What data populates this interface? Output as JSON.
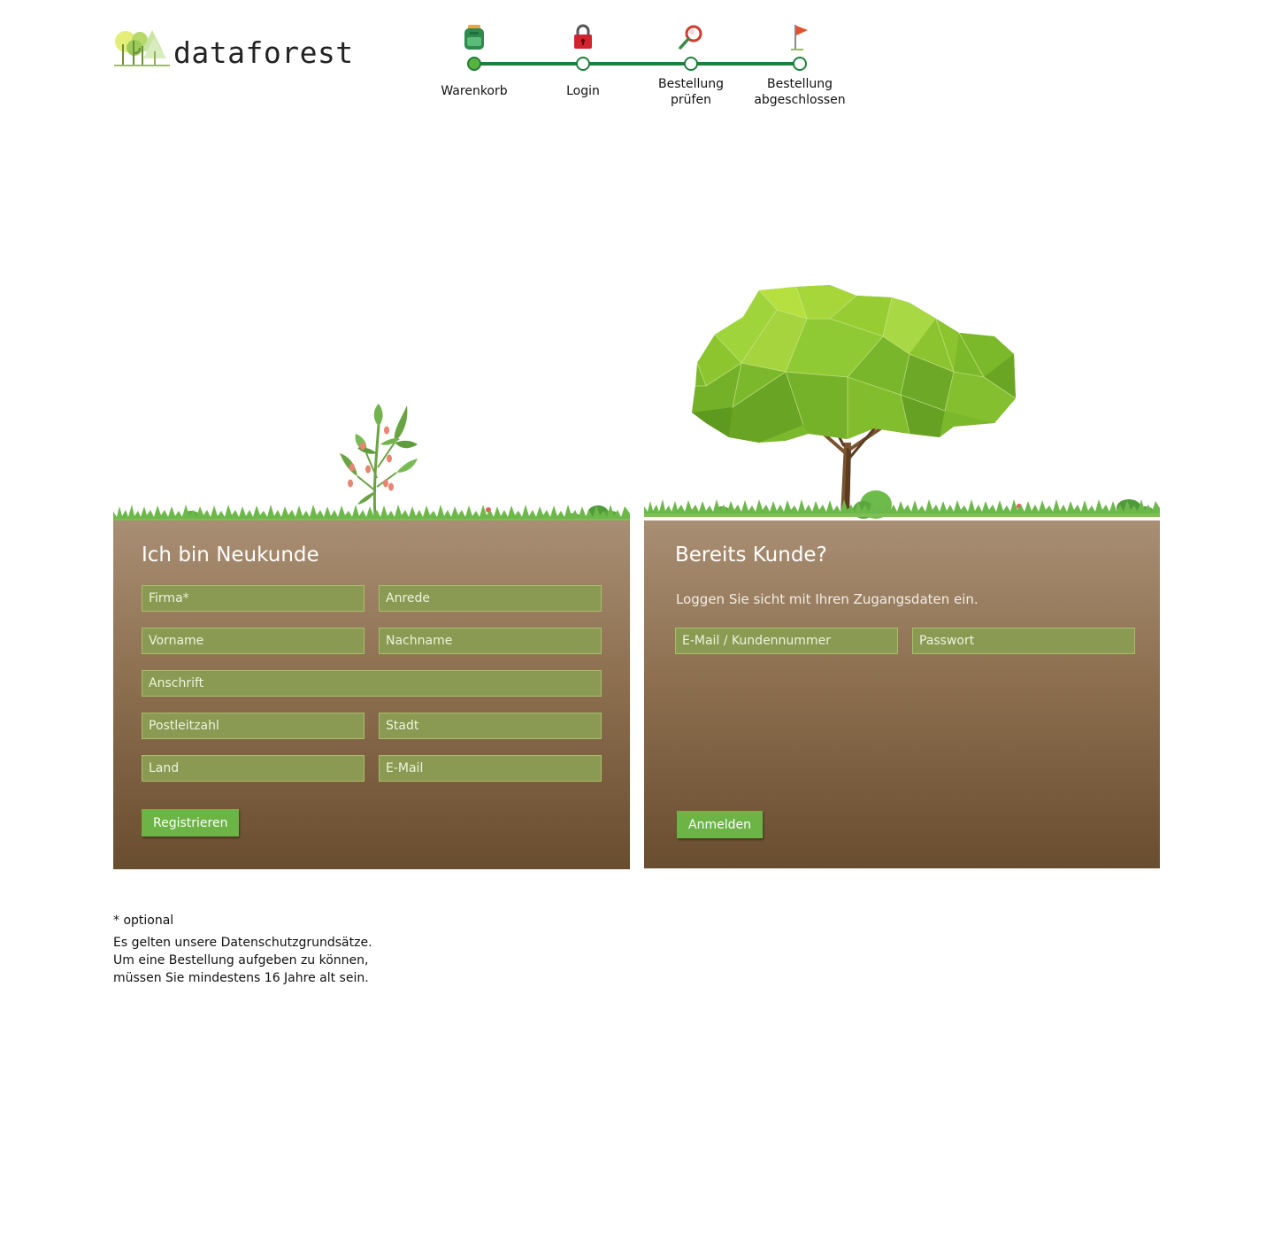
{
  "header": {
    "logo_text": "dataforest"
  },
  "stepper": {
    "steps": [
      {
        "label": "Warenkorb",
        "icon": "backpack-icon",
        "active": true
      },
      {
        "label": "Login",
        "icon": "lock-icon",
        "active": false
      },
      {
        "label": "Bestellung prüfen",
        "icon": "magnifier-icon",
        "active": false
      },
      {
        "label": "Bestellung abgeschlossen",
        "icon": "flag-icon",
        "active": false
      }
    ]
  },
  "register": {
    "title": "Ich bin Neukunde",
    "fields": {
      "firma": "Firma*",
      "anrede": "Anrede",
      "vorname": "Vorname",
      "nachname": "Nachname",
      "anschrift": "Anschrift",
      "plz": "Postleitzahl",
      "stadt": "Stadt",
      "land": "Land",
      "email": "E-Mail"
    },
    "button": "Registrieren"
  },
  "login": {
    "title": "Bereits Kunde?",
    "intro": "Loggen Sie sicht mit Ihren Zugangsdaten ein.",
    "fields": {
      "email": "E-Mail / Kundennummer",
      "password": "Passwort"
    },
    "button": "Anmelden"
  },
  "footer": {
    "optional": "* optional",
    "line1": "Es gelten unsere Datenschutzgrundsätze.",
    "line2": "Um eine Bestellung aufgeben zu können,",
    "line3": "müssen Sie mindestens 16 Jahre alt sein."
  },
  "colors": {
    "step_line": "#1e7f3c",
    "field_bg": "#8a9a53",
    "button_bg": "#6cb446",
    "soil_top": "#a88e73",
    "soil_bottom": "#694d2f"
  }
}
